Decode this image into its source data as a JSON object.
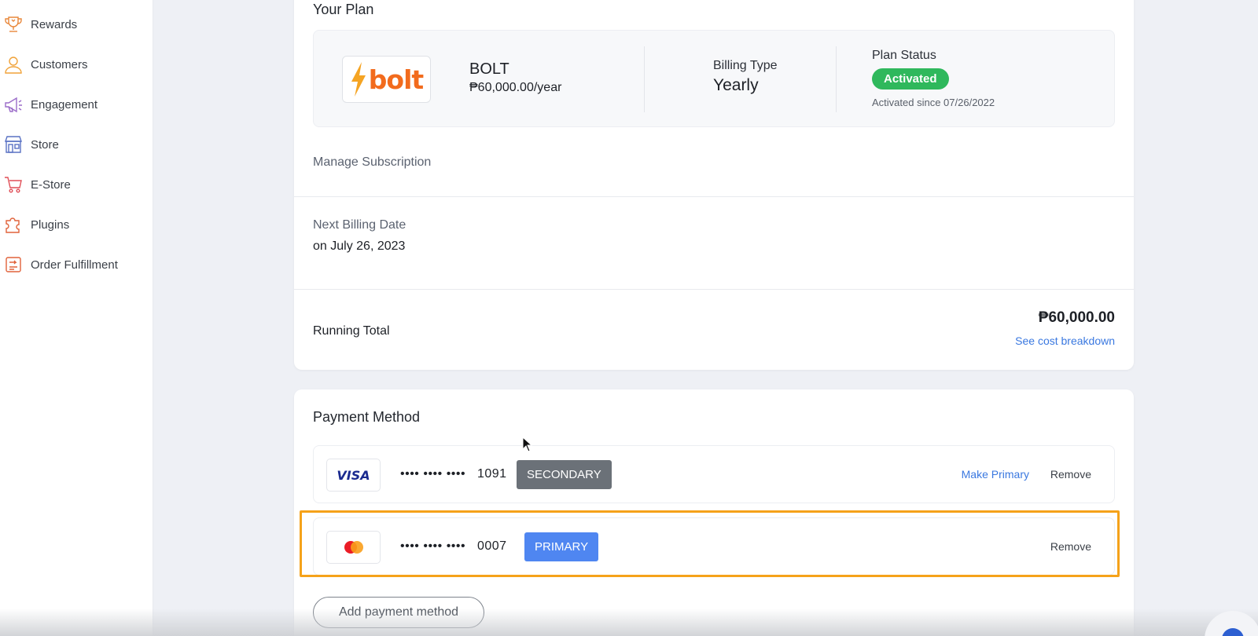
{
  "sidebar": {
    "items": [
      {
        "label": "Rewards",
        "icon": "trophy-icon"
      },
      {
        "label": "Customers",
        "icon": "user-icon"
      },
      {
        "label": "Engagement",
        "icon": "megaphone-icon"
      },
      {
        "label": "Store",
        "icon": "storefront-icon"
      },
      {
        "label": "E-Store",
        "icon": "cart-icon"
      },
      {
        "label": "Plugins",
        "icon": "puzzle-icon"
      },
      {
        "label": "Order Fulfillment",
        "icon": "receipt-icon"
      }
    ]
  },
  "plan": {
    "title": "Your Plan",
    "logo_text": "bolt",
    "name": "BOLT",
    "price": "₱60,000.00/year",
    "billing_type_label": "Billing Type",
    "billing_type_value": "Yearly",
    "status_label": "Plan Status",
    "status_value": "Activated",
    "status_since": "Activated since 07/26/2022",
    "manage_link": "Manage Subscription",
    "next_billing_label": "Next Billing Date",
    "next_billing_value": "on July 26, 2023",
    "running_total_label": "Running Total",
    "running_total_amount": "₱60,000.00",
    "cost_breakdown_link": "See cost breakdown"
  },
  "payment": {
    "title": "Payment Method",
    "cards": [
      {
        "brand": "VISA",
        "dots": "•••• •••• ••••",
        "last4": "1091",
        "tag": "SECONDARY",
        "make_primary": "Make Primary",
        "remove": "Remove"
      },
      {
        "brand": "mastercard",
        "dots": "•••• •••• ••••",
        "last4": "0007",
        "tag": "PRIMARY",
        "remove": "Remove"
      }
    ],
    "add_button": "Add payment method"
  },
  "colors": {
    "accent_blue": "#3a78e0",
    "primary_tag": "#4f86f1",
    "secondary_tag": "#6b7178",
    "activated_green": "#2fb85c",
    "highlight_orange": "#f5a21a",
    "bolt_orange": "#f26b1d"
  }
}
